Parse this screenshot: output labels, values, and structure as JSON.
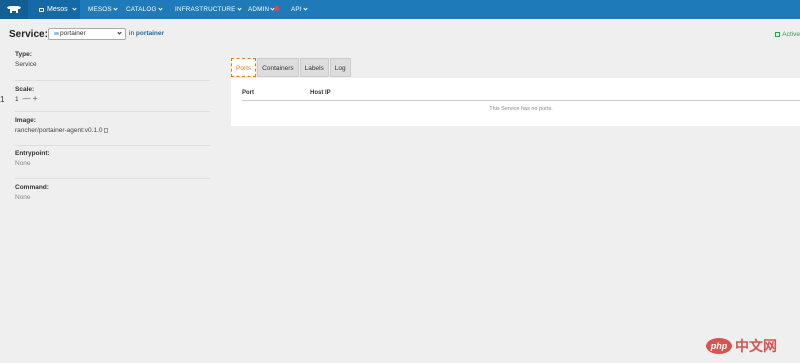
{
  "nav": {
    "environment": "Mesos",
    "items": [
      {
        "label": "MESOS"
      },
      {
        "label": "CATALOG"
      },
      {
        "label": "INFRASTRUCTURE"
      },
      {
        "label": "ADMIN"
      },
      {
        "label": "API"
      }
    ],
    "colors": {
      "bar": "#1f7ab9",
      "logo_bg": "#135f93",
      "env_bg": "#146aa6",
      "alert": "#e8453c"
    }
  },
  "header": {
    "service_label": "Service:",
    "service_select": "portainer",
    "in_text_prefix": "in",
    "stack_name": "portainer",
    "status": "Active"
  },
  "details": {
    "type_label": "Type:",
    "type_value": "Service",
    "scale_label": "Scale:",
    "scale_value": "1",
    "scale_minus": "—",
    "scale_plus": "+",
    "image_label": "Image:",
    "image_value": "rancher/portainer-agent:v0.1.0",
    "entrypoint_label": "Entrypoint:",
    "entrypoint_value": "None",
    "command_label": "Command:",
    "command_value": "None",
    "edge_char": "1"
  },
  "tabs": [
    {
      "label": "Ports",
      "active": true
    },
    {
      "label": "Containers",
      "active": false
    },
    {
      "label": "Labels",
      "active": false
    },
    {
      "label": "Log",
      "active": false
    }
  ],
  "ports_table": {
    "columns": [
      "Port",
      "Host IP"
    ],
    "empty_message": "This Service has no ports."
  },
  "watermark": {
    "badge": "php",
    "text": "中文网"
  }
}
